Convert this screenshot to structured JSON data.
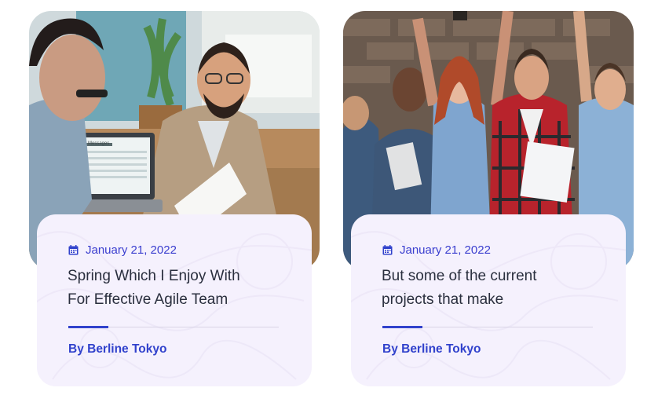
{
  "cards": [
    {
      "image": "office-meeting-laptop-photo",
      "laptop_window_title": "Messages",
      "date": "January 21, 2022",
      "title_line1": "Spring Which I Enjoy With",
      "title_line2": "For Effective Agile Team",
      "author": "By Berline Tokyo"
    },
    {
      "image": "team-celebrating-photo",
      "date": "January 21, 2022",
      "title_line1": "But some of the current",
      "title_line2": "projects that make",
      "author": "By Berline Tokyo"
    }
  ],
  "icons": {
    "date": "calendar-icon"
  },
  "colors": {
    "accent": "#3142cc",
    "card_bg": "#f5f1fd",
    "title": "#2a2f3e"
  }
}
